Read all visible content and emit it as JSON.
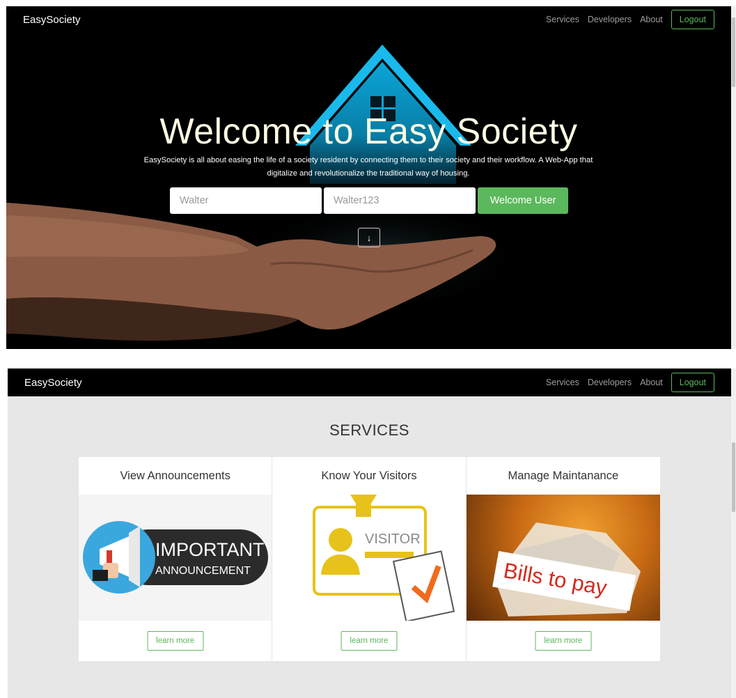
{
  "hero": {
    "brand": "EasySociety",
    "nav": [
      "Services",
      "Developers",
      "About"
    ],
    "logout_label": "Logout",
    "title": "Welcome to Easy Society",
    "subtitle": "EasySociety is all about easing the life of a society resident by connecting them to their society and their workflow. A Web-App that digitalize and revolutionalize the traditional way of housing.",
    "username_value": "Walter",
    "password_value": "Walter123",
    "welcome_button": "Welcome User",
    "scroll_arrow": "↓"
  },
  "services": {
    "brand": "EasySociety",
    "nav": [
      "Services",
      "Developers",
      "About"
    ],
    "logout_label": "Logout",
    "section_title": "SERVICES",
    "cards": [
      {
        "title": "View Announcements",
        "button": "learn more",
        "image_text": [
          "IMPORTANT",
          "ANNOUNCEMENT"
        ]
      },
      {
        "title": "Know Your Visitors",
        "button": "learn more",
        "image_text": [
          "VISITOR"
        ]
      },
      {
        "title": "Manage Maintanance",
        "button": "learn more",
        "image_text": [
          "Bills to pay"
        ]
      }
    ]
  },
  "colors": {
    "accent_green": "#5cb85c",
    "house_blue": "#1ab7e8",
    "hero_background": "#000000",
    "services_background": "#e7e7e7",
    "title_cream": "#fffbe3"
  }
}
